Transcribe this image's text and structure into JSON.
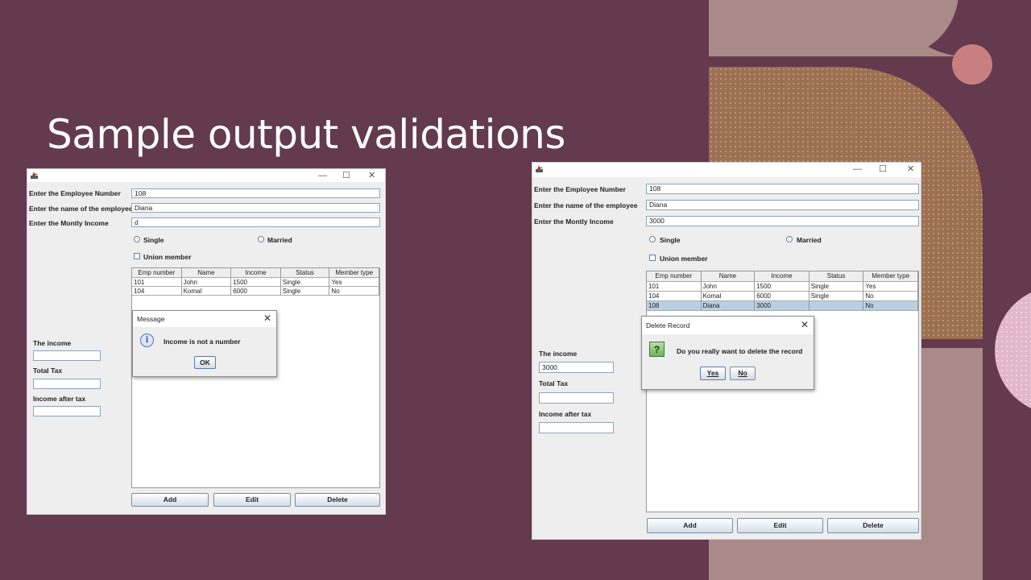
{
  "slide": {
    "title": "Sample output validations"
  },
  "colors": {
    "background": "#633a4e",
    "selected_row": "#b9cfe4"
  },
  "window_left": {
    "controls": {
      "minimize": "—",
      "maximize": "☐",
      "close": "✕"
    },
    "labels": {
      "emp_number": "Enter the Employee Number",
      "emp_name": "Enter the name of the employee",
      "income": "Enter the Montly Income"
    },
    "values": {
      "emp_number": "108",
      "emp_name": "Diana",
      "income": "d"
    },
    "radio": {
      "single": "Single",
      "married": "Married"
    },
    "checkbox": {
      "union": "Union member"
    },
    "table": {
      "headers": [
        "Emp number",
        "Name",
        "Income",
        "Status",
        "Member type"
      ],
      "rows": [
        [
          "101",
          "John",
          "1500",
          "Single",
          "Yes"
        ],
        [
          "104",
          "Komal",
          "6000",
          "Single",
          "No"
        ]
      ]
    },
    "outputs": {
      "income_label": "The income",
      "tax_label": "Total Tax",
      "after_tax_label": "Income after tax"
    },
    "buttons": {
      "add": "Add",
      "edit": "Edit",
      "delete": "Delete"
    },
    "dialog": {
      "title": "Message",
      "icon_glyph": "i",
      "message": "Income is not a number",
      "ok": "OK"
    }
  },
  "window_right": {
    "controls": {
      "minimize": "—",
      "maximize": "☐",
      "close": "✕"
    },
    "labels": {
      "emp_number": "Enter the Employee Number",
      "emp_name": "Enter the name of the employee",
      "income": "Enter the Montly Income"
    },
    "values": {
      "emp_number": "108",
      "emp_name": "Diana",
      "income": "3000"
    },
    "radio": {
      "single": "Single",
      "married": "Married"
    },
    "checkbox": {
      "union": "Union member"
    },
    "table": {
      "headers": [
        "Emp number",
        "Name",
        "Income",
        "Status",
        "Member type"
      ],
      "rows": [
        [
          "101",
          "John",
          "1500",
          "Single",
          "Yes"
        ],
        [
          "104",
          "Komal",
          "6000",
          "Single",
          "No"
        ],
        [
          "108",
          "Diana",
          "3000",
          "",
          "No"
        ]
      ]
    },
    "outputs": {
      "income_label": "The income",
      "income_value": "3000",
      "tax_label": "Total Tax",
      "after_tax_label": "Income after tax"
    },
    "buttons": {
      "add": "Add",
      "edit": "Edit",
      "delete": "Delete"
    },
    "dialog": {
      "title": "Delete Record",
      "icon_glyph": "?",
      "message": "Do you really want to delete the record",
      "yes": "Yes",
      "no": "No"
    }
  }
}
